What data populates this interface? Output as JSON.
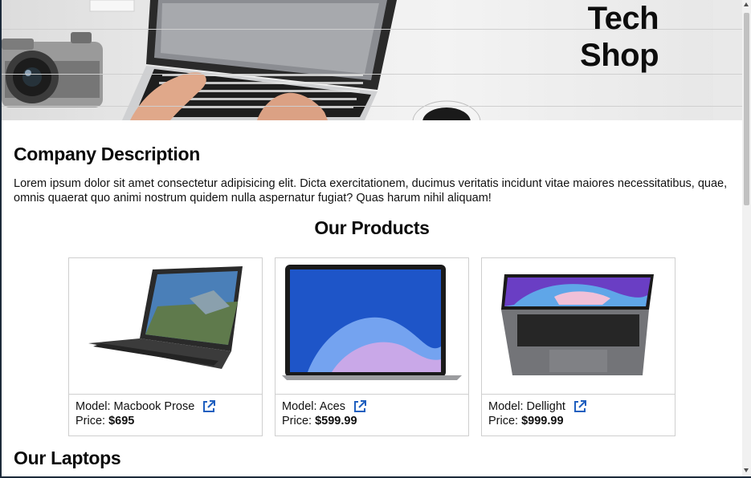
{
  "hero": {
    "title_line1": "Tech",
    "title_line2": "Shop",
    "image_icon": "desk-laptop-camera-coffee-photo"
  },
  "about": {
    "heading": "Company Description",
    "text": "Lorem ipsum dolor sit amet consectetur adipisicing elit. Dicta exercitationem, ducimus veritatis incidunt vitae maiores necessitatibus, quae, omnis quaerat quo animi nostrum quidem nulla aspernatur fugiat? Quas harum nihil aliquam!"
  },
  "products": {
    "heading": "Our Products",
    "price_label": "Price:",
    "items": [
      {
        "model_label": "Model: Macbook Prose",
        "price": "$695",
        "image": "hp-laptop-photo"
      },
      {
        "model_label": "Model: Aces",
        "price": "$599.99",
        "image": "macbook-air-photo"
      },
      {
        "model_label": "Model: Dellight",
        "price": "$999.99",
        "image": "macbook-pro-photo"
      }
    ],
    "link_icon": "external-link-icon"
  },
  "laptops": {
    "heading": "Our Laptops"
  },
  "colors": {
    "accent_link": "#1f5fbf",
    "frame": "#1c2a3a",
    "card_border": "#cfcfcf"
  }
}
